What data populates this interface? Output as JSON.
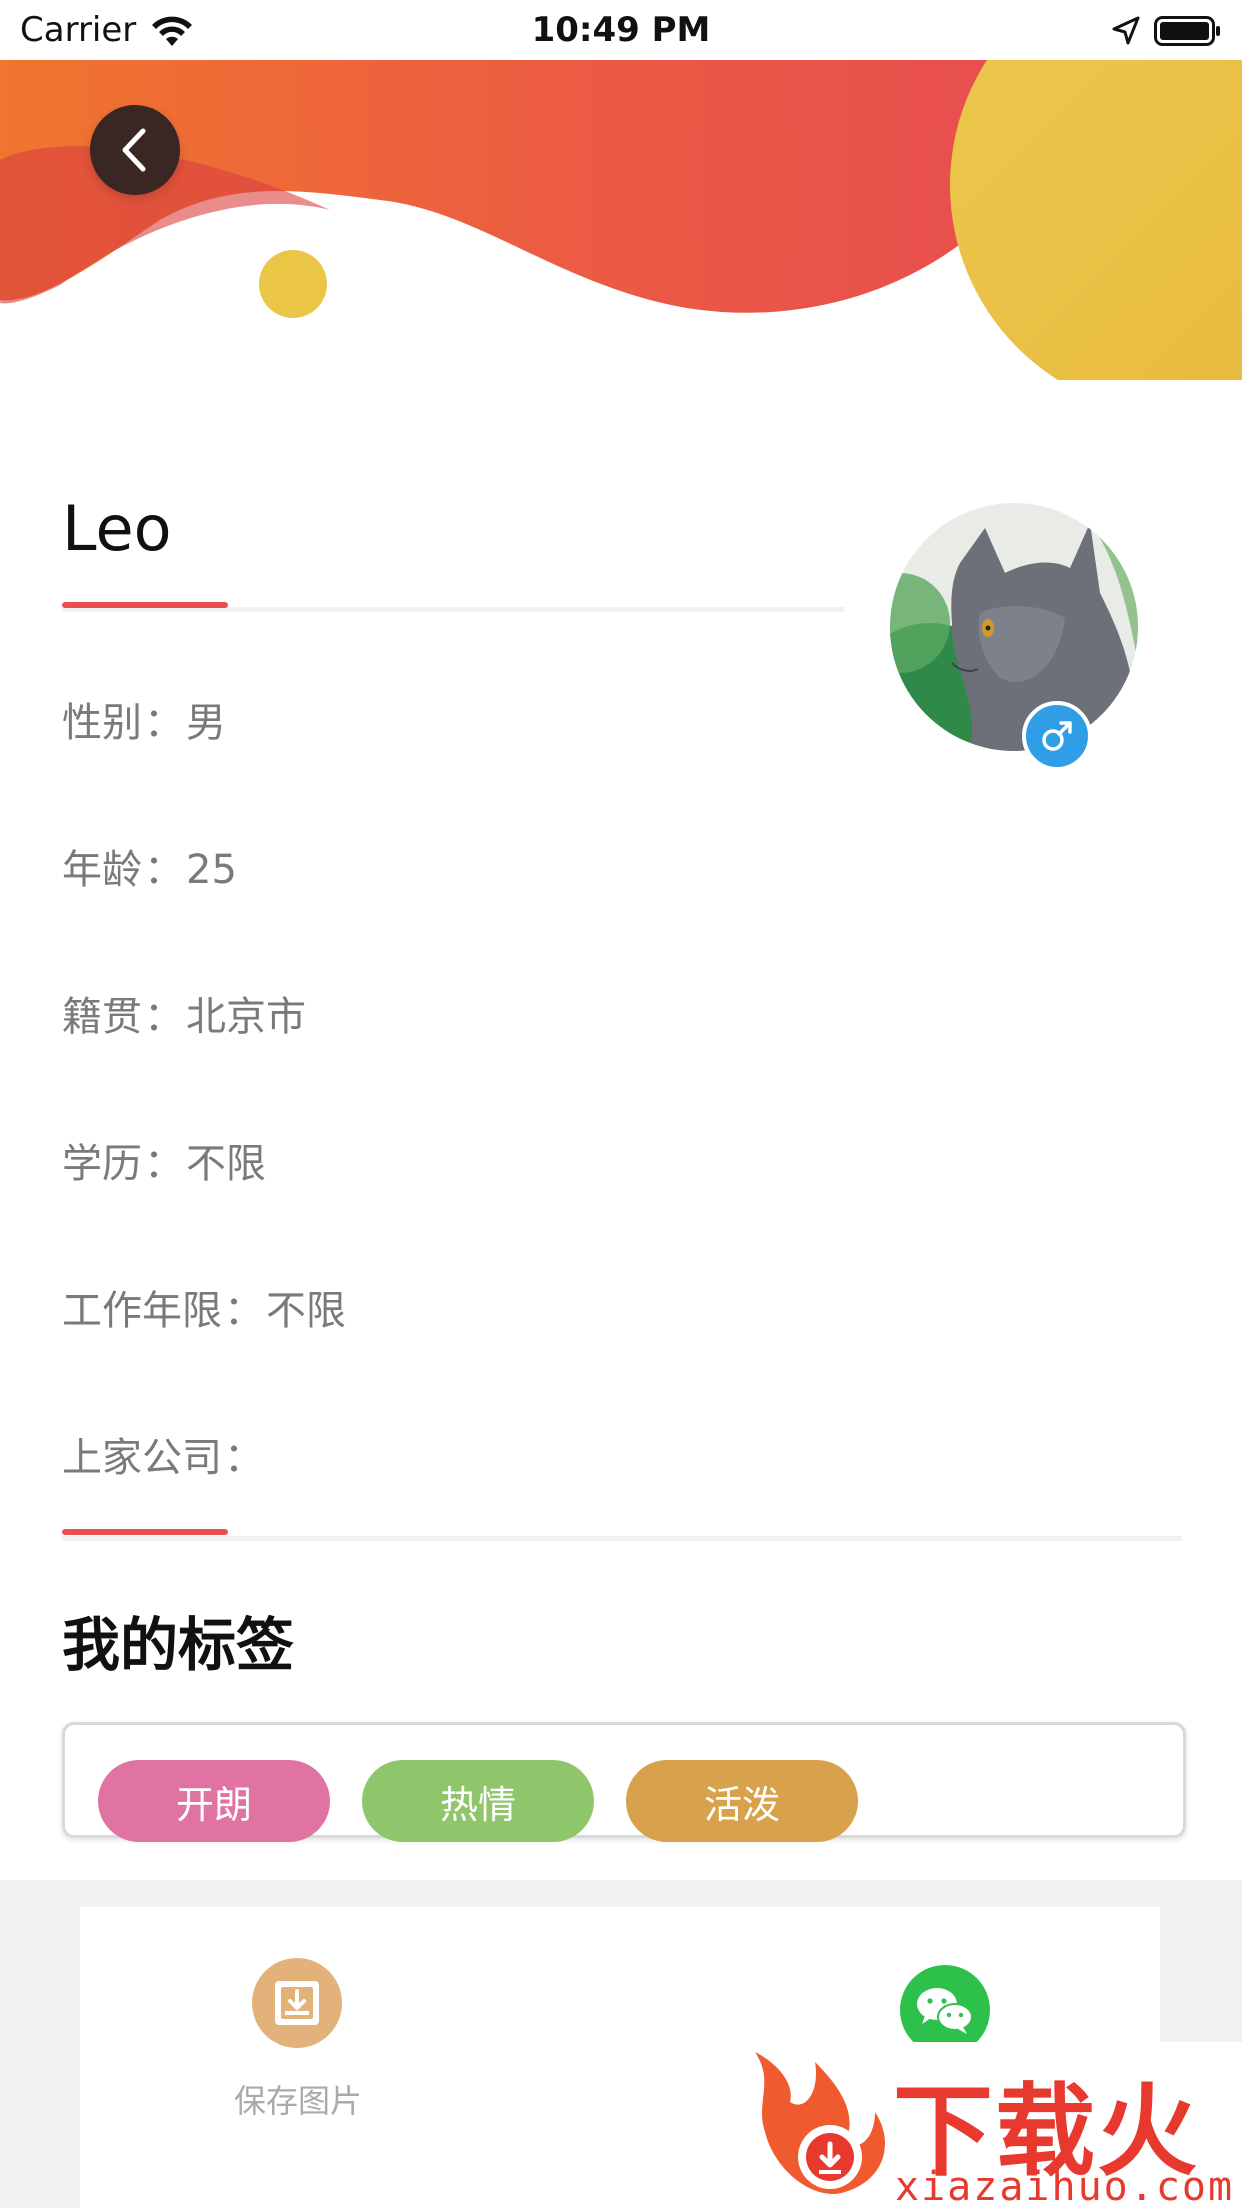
{
  "status_bar": {
    "carrier": "Carrier",
    "time": "10:49 PM"
  },
  "profile": {
    "name": "Leo",
    "gender_icon": "male-symbol-icon",
    "info_rows": [
      {
        "label": "性别",
        "value": "男"
      },
      {
        "label": "年龄",
        "value": "25"
      },
      {
        "label": "籍贯",
        "value": "北京市"
      },
      {
        "label": "学历",
        "value": "不限"
      },
      {
        "label": "工作年限",
        "value": "不限"
      },
      {
        "label": "上家公司",
        "value": ""
      }
    ],
    "separator": "："
  },
  "tags_section": {
    "title": "我的标签",
    "tags": [
      {
        "label": "开朗",
        "color": "#e073a2"
      },
      {
        "label": "热情",
        "color": "#8fc66c"
      },
      {
        "label": "活泼",
        "color": "#d8a24c"
      }
    ]
  },
  "actions": {
    "save_label": "保存图片",
    "save_icon": "download-box-icon",
    "wechat_icon": "wechat-icon"
  },
  "watermark": {
    "text": "下载火",
    "url": "xiazaihuo.com"
  },
  "colors": {
    "accent_red": "#e94f4f",
    "banner_orange": "#ee6a36",
    "banner_yellow": "#e9bf45",
    "badge_blue": "#2f9ee6"
  }
}
